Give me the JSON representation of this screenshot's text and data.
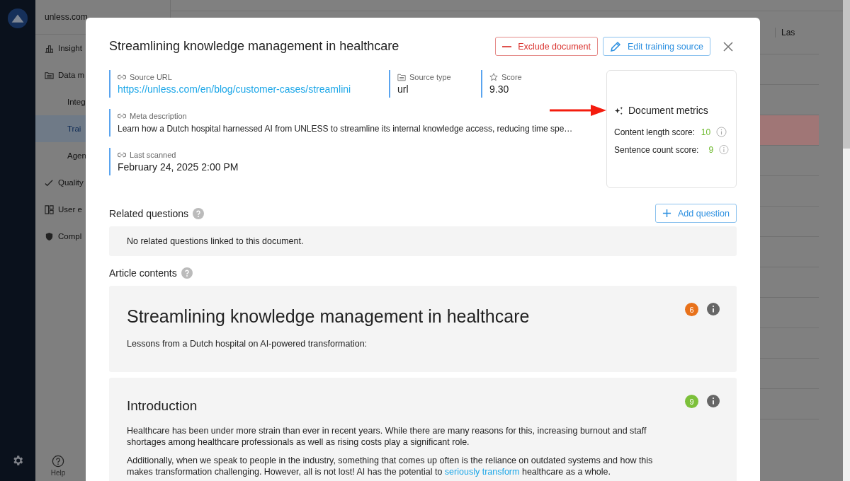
{
  "sidebar": {
    "org": "unless.com",
    "items": [
      {
        "label": "Insight",
        "kind": "top",
        "selected": false
      },
      {
        "label": "Data m",
        "kind": "top",
        "selected": false
      },
      {
        "label": "Integ",
        "kind": "sub",
        "selected": false
      },
      {
        "label": "Trai",
        "kind": "sub",
        "selected": true
      },
      {
        "label": "Agen",
        "kind": "sub",
        "selected": false
      },
      {
        "label": "Quality",
        "kind": "top",
        "selected": false
      },
      {
        "label": "User e",
        "kind": "top",
        "selected": false
      },
      {
        "label": "Compl",
        "kind": "top",
        "selected": false
      }
    ],
    "help": "Help"
  },
  "table": {
    "column_header": "Las",
    "rows": [
      {
        "highlighted": false
      },
      {
        "highlighted": false
      },
      {
        "highlighted": true
      },
      {
        "highlighted": false
      },
      {
        "highlighted": false
      },
      {
        "highlighted": false
      },
      {
        "highlighted": false
      },
      {
        "highlighted": false
      },
      {
        "highlighted": false
      },
      {
        "highlighted": false
      },
      {
        "highlighted": false
      },
      {
        "highlighted": false
      }
    ]
  },
  "modal": {
    "title": "Streamlining knowledge management in healthcare",
    "buttons": [
      {
        "label": "Exclude document",
        "kind": "danger"
      },
      {
        "label": "Edit training source",
        "kind": "edit"
      }
    ],
    "fields": [
      {
        "label": "Source URL",
        "value": "https://unless.com/en/blog/customer-cases/streamlini",
        "kind": "link"
      },
      {
        "label": "Source type",
        "value": "url",
        "kind": "text"
      },
      {
        "label": "Score",
        "value": "9.30",
        "kind": "text"
      },
      {
        "label": "Meta description",
        "value": "Learn how a Dutch hospital harnessed AI from UNLESS to streamline its internal knowledge access, reducing time spe…",
        "kind": "small"
      },
      {
        "label": "Last scanned",
        "value": "February 24, 2025 2:00 PM",
        "kind": "text"
      }
    ],
    "metrics": {
      "title": "Document metrics",
      "items": [
        {
          "label": "Content length score:",
          "value": "10"
        },
        {
          "label": "Sentence count score:",
          "value": "9"
        }
      ]
    },
    "related": {
      "title": "Related questions",
      "button": "Add question",
      "empty": "No related questions linked to this document."
    },
    "article": {
      "title": "Article contents",
      "blocks": [
        {
          "heading": "Streamlining knowledge management in healthcare",
          "kind": "h1",
          "score": "6",
          "color": "#e8711a",
          "paragraphs": [
            [
              {
                "kind": "text",
                "text": "Lessons from a Dutch hospital on AI-powered transformation:"
              }
            ]
          ]
        },
        {
          "heading": "Introduction",
          "kind": "h2",
          "score": "9",
          "color": "#7cc03a",
          "paragraphs": [
            [
              {
                "kind": "text",
                "text": "Healthcare has been under more strain than ever in recent years. While there are many reasons for this, increasing burnout and staff shortages among healthcare professionals as well as rising costs play a significant role."
              }
            ],
            [
              {
                "kind": "text",
                "text": "Additionally, when we speak to people in the industry, something that comes up often is the reliance on outdated systems and how this makes transformation challenging. However, all is not lost! AI has the potential to "
              },
              {
                "kind": "link",
                "text": "seriously transform"
              },
              {
                "kind": "text",
                "text": " healthcare as a whole."
              }
            ]
          ]
        }
      ]
    }
  }
}
